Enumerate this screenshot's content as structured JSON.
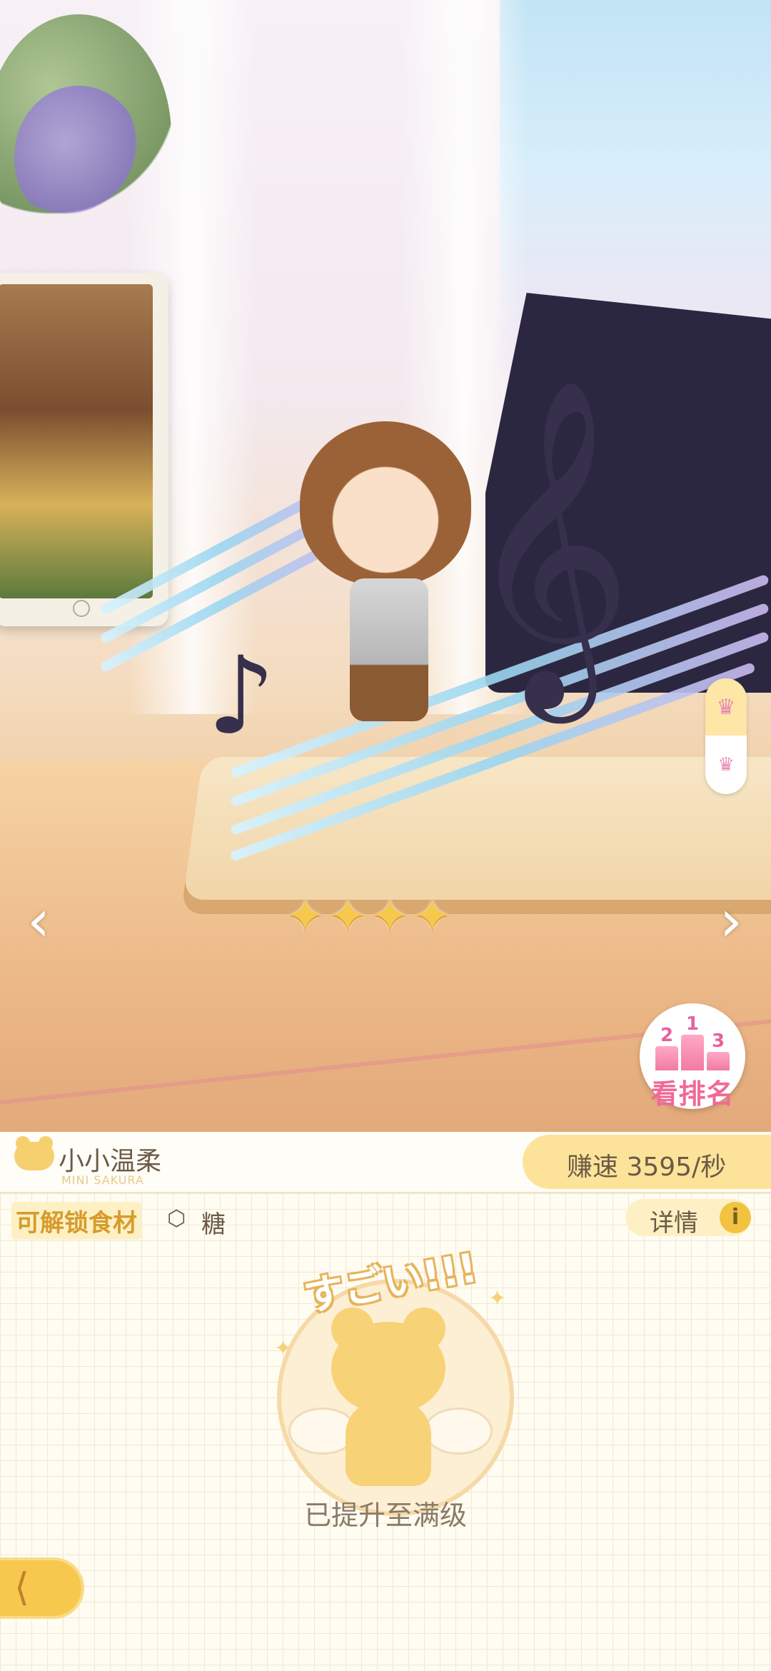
{
  "game": {
    "stars": {
      "filled": 4,
      "total": 4
    },
    "rank_button": {
      "label": "看排名",
      "podium_numbers": [
        "2",
        "1",
        "3"
      ]
    },
    "nav": {
      "prev_icon": "chevron-left-icon",
      "next_icon": "chevron-right-icon"
    },
    "crown_tabs": [
      "crown-icon",
      "crown-icon"
    ]
  },
  "info_bar": {
    "brand_name": "小小温柔",
    "brand_sub": "MINI SAKURA",
    "speed_label": "赚速 3595/秒"
  },
  "panel": {
    "unlock_label": "可解锁食材",
    "ingredient_name": "糖",
    "detail_label": "详情",
    "info_icon": "i",
    "badge_text": "すごい!!!",
    "status_text": "已提升至满级"
  },
  "colors": {
    "accent": "#f6c94e",
    "text": "#6b5a45",
    "rank_pink": "#f06a97"
  }
}
